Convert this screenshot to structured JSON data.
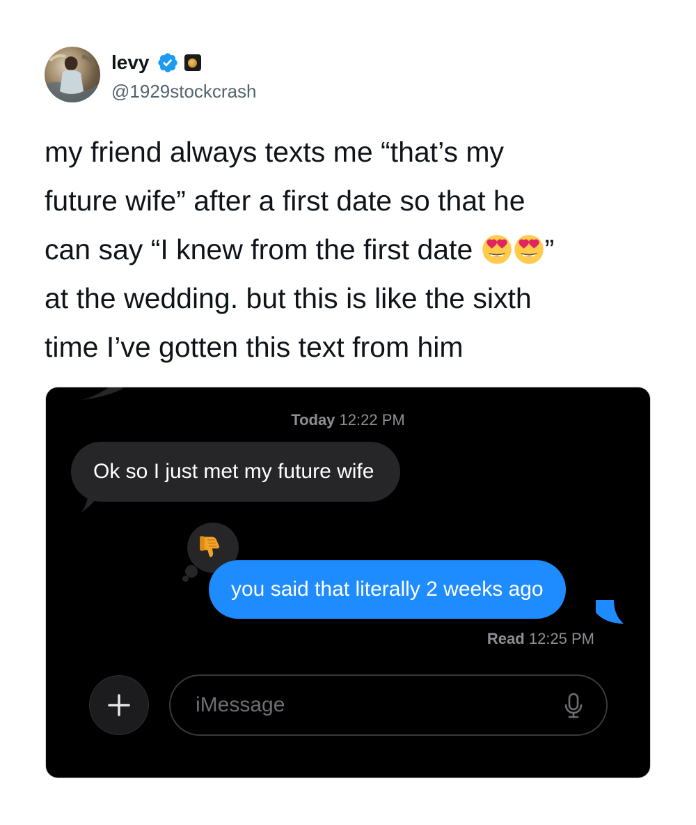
{
  "author": {
    "name": "levy",
    "handle": "@1929stockcrash",
    "verified_icon": "verified-badge-icon",
    "affiliate_icon": "affiliate-badge-icon"
  },
  "tweet": {
    "lines": [
      "my friend always texts me “that’s my",
      "future wife” after a first date so that he",
      "can say “I knew from the first date",
      "at the wedding. but this is like the sixth",
      "time I’ve gotten this text from him"
    ],
    "line3_suffix": "”",
    "emojis": [
      "smiling-face-with-heart-eyes",
      "smiling-face-with-heart-eyes"
    ]
  },
  "screenshot": {
    "timestamp_day": "Today",
    "timestamp_time": "12:22 PM",
    "incoming_message": "Ok so I just met my future wife",
    "outgoing_message": "you said that literally 2 weeks ago",
    "tapback_icon": "thumbs-down-icon",
    "read_label": "Read",
    "read_time": "12:25 PM",
    "input_placeholder": "iMessage",
    "plus_icon": "plus-icon",
    "mic_icon": "microphone-icon"
  },
  "colors": {
    "background": "#ffffff",
    "text": "#0f1419",
    "handle": "#536471",
    "verified": "#1d9bf0",
    "imessage_blue": "#1e8cff",
    "incoming_bubble": "#262628",
    "screen_bg": "#000000"
  }
}
